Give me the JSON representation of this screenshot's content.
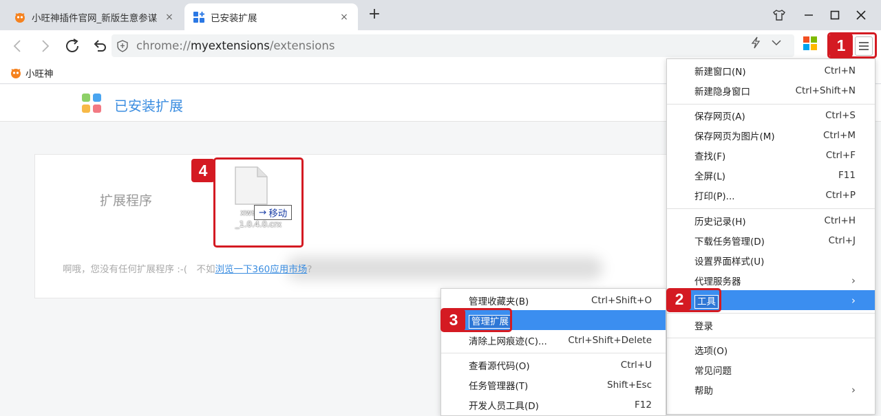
{
  "tabs": [
    {
      "title": "小旺神插件官网_新版生意参谋",
      "close": "×",
      "active": false
    },
    {
      "title": "已安装扩展",
      "close": "×",
      "active": true
    }
  ],
  "new_tab": "+",
  "address_bar": {
    "scheme": "chrome://",
    "host": "myextensions",
    "path": "/extensions"
  },
  "bookmarks": [
    {
      "label": "小旺神"
    }
  ],
  "page": {
    "title": "已安装扩展",
    "section_label": "扩展程序",
    "empty_prefix": "啊哦，您没有任何扩展程序 :-(　不如",
    "empty_link": "浏览一下360应用市场",
    "empty_suffix": "?"
  },
  "drag_file": {
    "name_line1": "xws_ch...",
    "name_line2": "_1.0.4.0.crx",
    "drop_hint": "移动",
    "drop_arrow": "→"
  },
  "main_menu": {
    "items": [
      {
        "label": "新建窗口(N)",
        "shortcut": "Ctrl+N"
      },
      {
        "label": "新建隐身窗口",
        "shortcut": "Ctrl+Shift+N"
      },
      {
        "label": "保存网页(A)",
        "shortcut": "Ctrl+S"
      },
      {
        "label": "保存网页为图片(M)",
        "shortcut": "Ctrl+M"
      },
      {
        "label": "查找(F)",
        "shortcut": "Ctrl+F"
      },
      {
        "label": "全屏(L)",
        "shortcut": "F11"
      },
      {
        "label": "打印(P)...",
        "shortcut": "Ctrl+P"
      },
      {
        "label": "历史记录(H)",
        "shortcut": "Ctrl+H"
      },
      {
        "label": "下载任务管理(D)",
        "shortcut": "Ctrl+J"
      },
      {
        "label": "设置界面样式(U)",
        "shortcut": ""
      },
      {
        "label": "代理服务器",
        "shortcut": "›"
      },
      {
        "label": "工具",
        "shortcut": "›"
      },
      {
        "label": "登录",
        "shortcut": ""
      },
      {
        "label": "选项(O)",
        "shortcut": ""
      },
      {
        "label": "常见问题",
        "shortcut": ""
      },
      {
        "label": "帮助",
        "shortcut": "›"
      }
    ]
  },
  "tools_submenu": {
    "items": [
      {
        "label": "管理收藏夹(B)",
        "shortcut": "Ctrl+Shift+O"
      },
      {
        "label": "管理扩展",
        "shortcut": ""
      },
      {
        "label": "清除上网痕迹(C)...",
        "shortcut": "Ctrl+Shift+Delete"
      },
      {
        "label": "查看源代码(O)",
        "shortcut": "Ctrl+U"
      },
      {
        "label": "任务管理器(T)",
        "shortcut": "Shift+Esc"
      },
      {
        "label": "开发人员工具(D)",
        "shortcut": "F12"
      }
    ]
  },
  "step_badges": [
    "1",
    "2",
    "3",
    "4"
  ],
  "colors": {
    "accent": "#3b8ef0",
    "highlight": "#d41a22",
    "title_blue": "#3b8de0"
  },
  "icons": [
    "back-icon",
    "forward-icon",
    "reload-icon",
    "undo-icon",
    "shield-icon",
    "lightning-icon",
    "chevron-down-icon",
    "apps-icon",
    "menu-icon",
    "minimize-icon",
    "maximize-icon",
    "close-icon",
    "skin-icon"
  ]
}
